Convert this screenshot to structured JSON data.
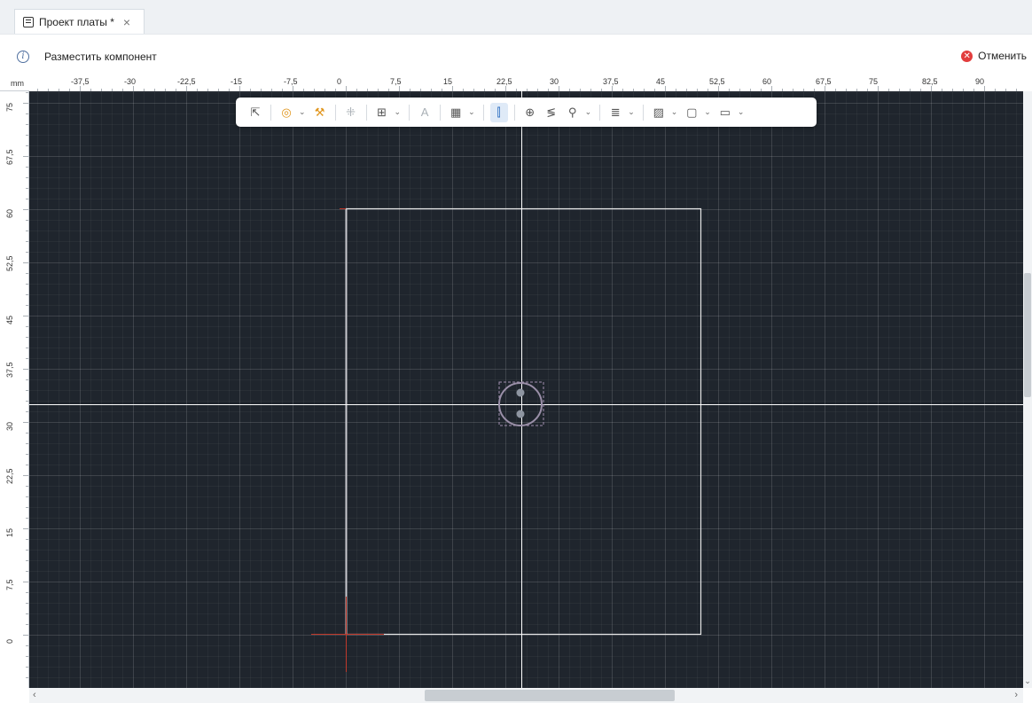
{
  "tab": {
    "title": "Проект платы *",
    "close": "×"
  },
  "info": {
    "message": "Разместить компонент",
    "icon": "i"
  },
  "cancel": {
    "label": "Отменить",
    "icon": "✕"
  },
  "ruler": {
    "unit": "mm",
    "x_labels": [
      "-37,5",
      "-30",
      "-22,5",
      "-15",
      "-7,5",
      "0",
      "7,5",
      "15",
      "22,5",
      "30",
      "37,5",
      "45",
      "52,5",
      "60",
      "67,5",
      "75",
      "82,5",
      "90"
    ],
    "y_labels": [
      "75",
      "67,5",
      "60",
      "52,5",
      "45",
      "37,5",
      "30",
      "22,5",
      "15",
      "7,5",
      "0"
    ]
  },
  "toolbar": {
    "select": "⇱",
    "route": "◎",
    "brush": "⚒",
    "grid": "⁜",
    "align": "⊞",
    "text": "A",
    "table": "▦",
    "pin": "⫿",
    "target": "⊕",
    "diff": "≶",
    "probe": "⚲",
    "lines": "≣",
    "hatch": "▨",
    "frame": "▢",
    "monitor": "▭",
    "caret": "⌄"
  },
  "scroll": {
    "left": "‹",
    "right": "›",
    "down": "⌄"
  },
  "colors": {
    "canvas": "#1f252d",
    "board": "#e6e6e6",
    "crosshair": "#ffffff",
    "origin": "#c0392b"
  }
}
